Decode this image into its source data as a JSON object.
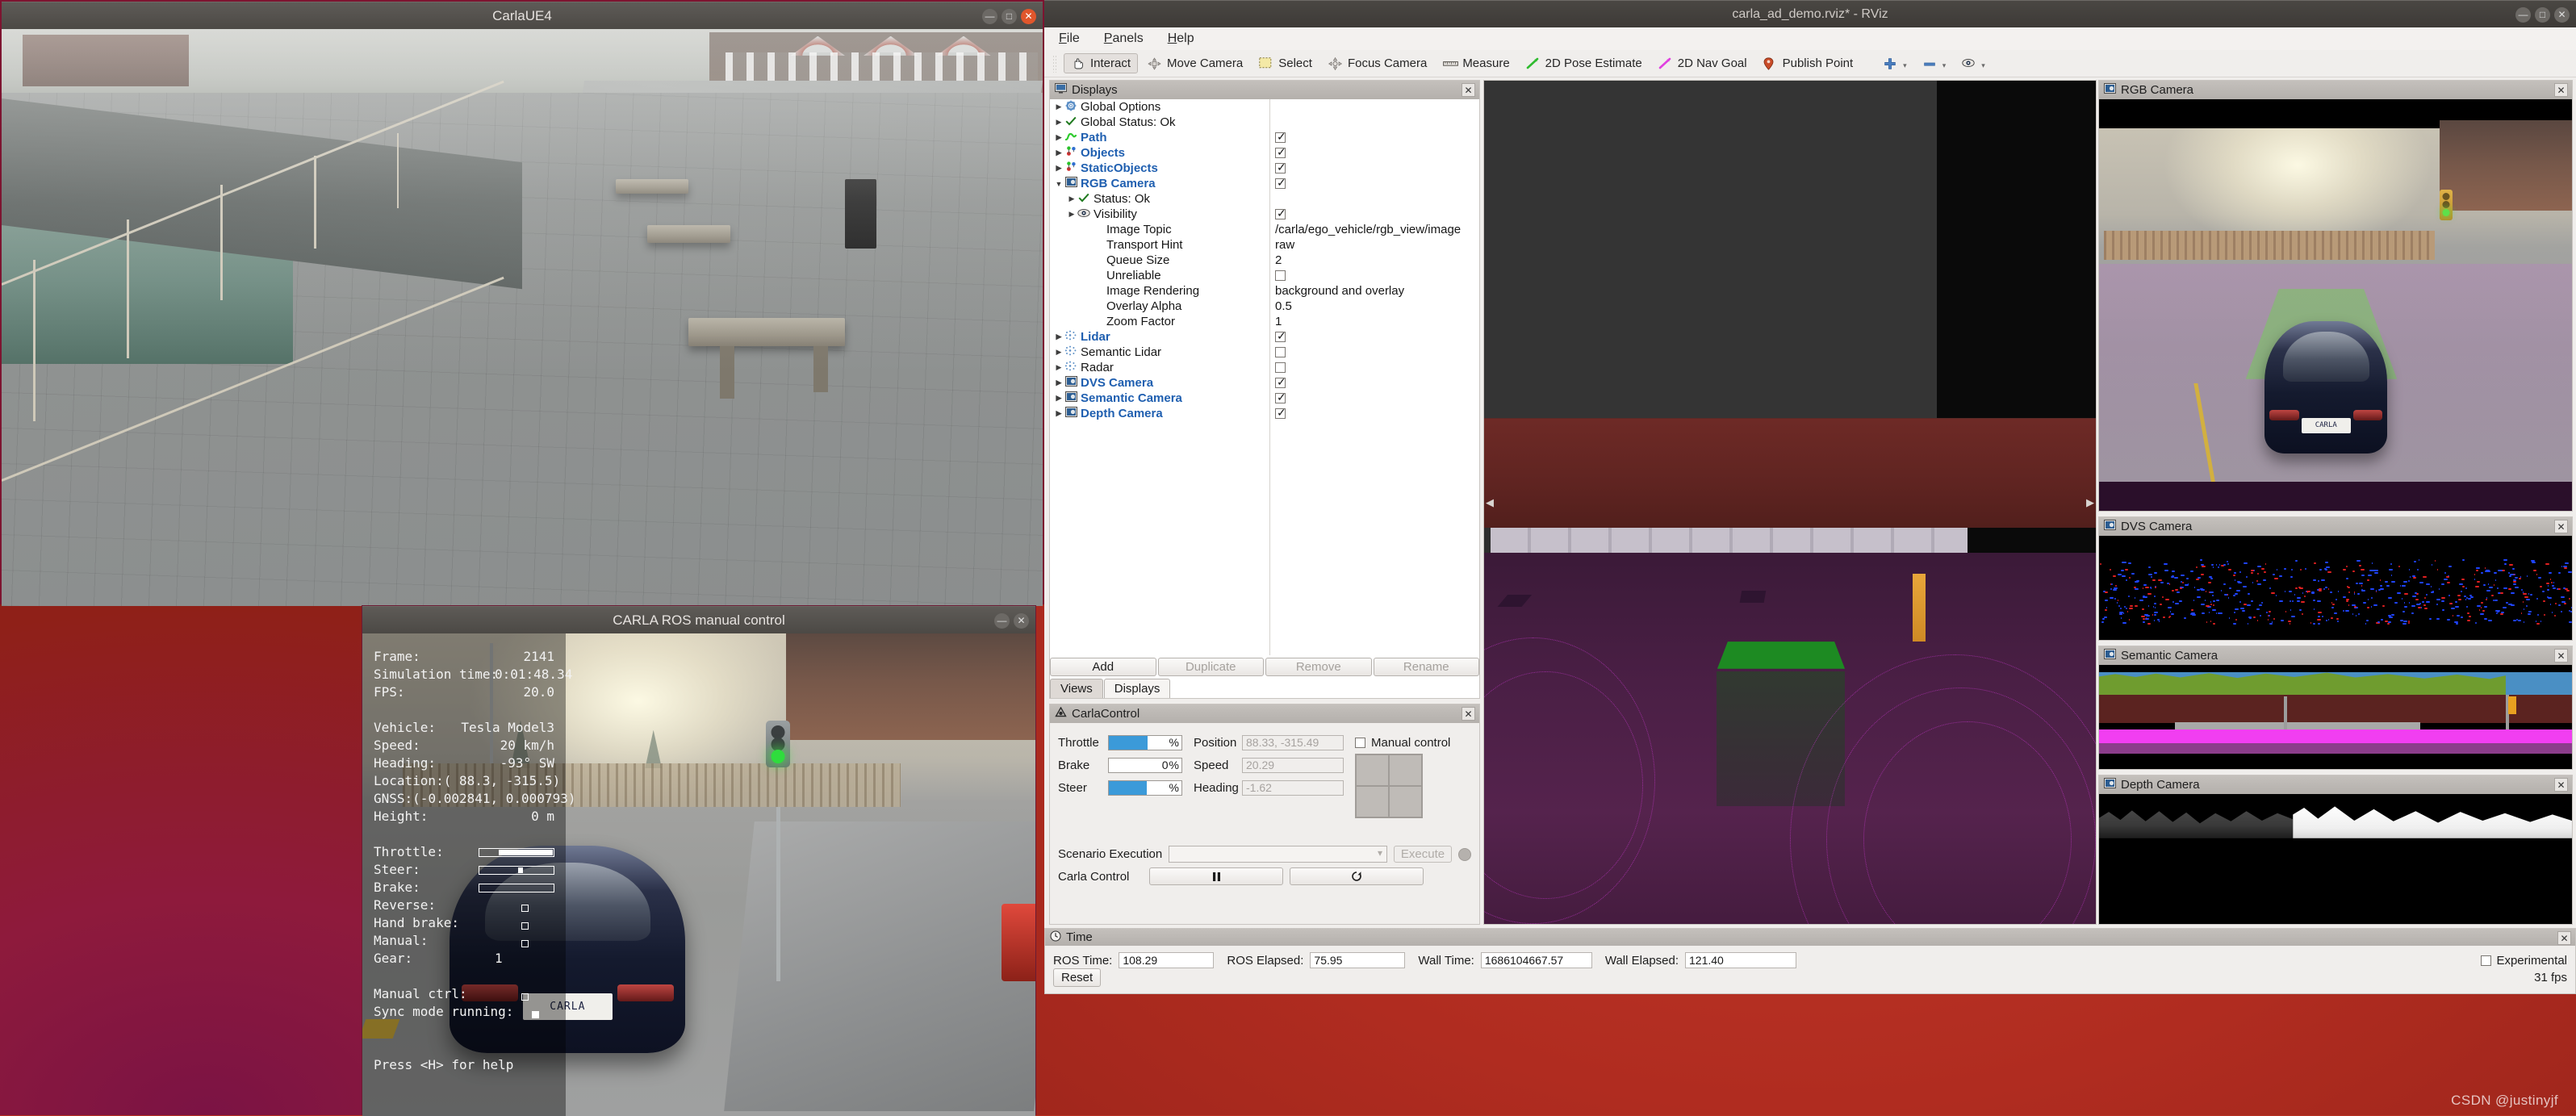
{
  "desktop": {
    "watermark": "CSDN @justinyjf"
  },
  "carla_ue4": {
    "title": "CarlaUE4",
    "buttons": {
      "minimize": "—",
      "maximize": "□",
      "close": "✕"
    }
  },
  "manual_control": {
    "title": "CARLA ROS manual control",
    "buttons": {
      "minimize": "—",
      "close": "✕"
    },
    "hud": {
      "frame_label": "Frame:",
      "frame_value": "2141",
      "sim_time_label": "Simulation time:",
      "sim_time_value": "0:01:48.34",
      "fps_label": "FPS:",
      "fps_value": "20.0",
      "vehicle_label": "Vehicle:",
      "vehicle_value": "Tesla Model3",
      "speed_label": "Speed:",
      "speed_value": "20 km/h",
      "heading_label": "Heading:",
      "heading_value": "-93° SW",
      "location_label": "Location:",
      "location_value": "( 88.3, -315.5)",
      "gnss_label": "GNSS:",
      "gnss_value": "(-0.002841, 0.000793)",
      "height_label": "Height:",
      "height_value": "0 m",
      "throttle_label": "Throttle:",
      "throttle_pct": 74,
      "steer_label": "Steer:",
      "steer_pct": 52,
      "brake_label": "Brake:",
      "brake_pct": 0,
      "reverse_label": "Reverse:",
      "reverse_on": false,
      "hand_brake_label": "Hand brake:",
      "hand_brake_on": false,
      "manual_label": "Manual:",
      "manual_on": false,
      "gear_label": "Gear:",
      "gear_value": "1",
      "manual_ctrl_label": "Manual ctrl:",
      "manual_ctrl_on": false,
      "sync_mode_label": "Sync mode running:",
      "sync_mode_on": true,
      "help_text": "Press <H> for help"
    },
    "scene": {
      "plate_text": "CARLA"
    }
  },
  "rviz": {
    "title": "carla_ad_demo.rviz* - RViz",
    "buttons": {
      "minimize": "—",
      "maximize": "□",
      "close": "✕"
    },
    "menu": [
      {
        "label": "File",
        "mnemonic": "F"
      },
      {
        "label": "Panels",
        "mnemonic": "P"
      },
      {
        "label": "Help",
        "mnemonic": "H"
      }
    ],
    "toolbar": [
      {
        "label": "Interact",
        "icon": "hand-icon",
        "active": true
      },
      {
        "label": "Move Camera",
        "icon": "move-camera-icon",
        "active": false
      },
      {
        "label": "Select",
        "icon": "select-rect-icon",
        "active": false
      },
      {
        "label": "Focus Camera",
        "icon": "focus-camera-icon",
        "active": false
      },
      {
        "label": "Measure",
        "icon": "ruler-icon",
        "active": false
      },
      {
        "label": "2D Pose Estimate",
        "icon": "pose-arrow-icon",
        "active": false
      },
      {
        "label": "2D Nav Goal",
        "icon": "nav-goal-arrow-icon",
        "active": false
      },
      {
        "label": "Publish Point",
        "icon": "map-pin-icon",
        "active": false
      }
    ],
    "toolbar_extra": [
      {
        "icon": "plus-icon"
      },
      {
        "icon": "minus-icon"
      },
      {
        "icon": "eye-icon"
      }
    ],
    "displays_panel": {
      "title": "Displays",
      "close_label": "✕",
      "tree": [
        {
          "label": "Global Options",
          "icon": "gear-icon",
          "arrow": true,
          "indent": 0,
          "blue": false,
          "value": null,
          "check": null
        },
        {
          "label": "Global Status: Ok",
          "icon": "check-icon",
          "arrow": true,
          "indent": 0,
          "blue": false,
          "value": null,
          "check": null
        },
        {
          "label": "Path",
          "icon": "path-icon",
          "arrow": true,
          "indent": 0,
          "blue": true,
          "value": null,
          "check": true
        },
        {
          "label": "Objects",
          "icon": "markers-icon",
          "arrow": true,
          "indent": 0,
          "blue": true,
          "value": null,
          "check": true
        },
        {
          "label": "StaticObjects",
          "icon": "markers-icon",
          "arrow": true,
          "indent": 0,
          "blue": true,
          "value": null,
          "check": true
        },
        {
          "label": "RGB Camera",
          "icon": "camera-icon",
          "arrow": "down",
          "indent": 0,
          "blue": true,
          "value": null,
          "check": true
        },
        {
          "label": "Status: Ok",
          "icon": "check-icon",
          "arrow": true,
          "indent": 1,
          "blue": false,
          "value": null,
          "check": null
        },
        {
          "label": "Visibility",
          "icon": "eye-icon",
          "arrow": true,
          "indent": 1,
          "blue": false,
          "value": null,
          "check": true
        },
        {
          "label": "Image Topic",
          "icon": null,
          "arrow": false,
          "indent": 2,
          "blue": false,
          "value": "/carla/ego_vehicle/rgb_view/image",
          "check": null
        },
        {
          "label": "Transport Hint",
          "icon": null,
          "arrow": false,
          "indent": 2,
          "blue": false,
          "value": "raw",
          "check": null
        },
        {
          "label": "Queue Size",
          "icon": null,
          "arrow": false,
          "indent": 2,
          "blue": false,
          "value": "2",
          "check": null
        },
        {
          "label": "Unreliable",
          "icon": null,
          "arrow": false,
          "indent": 2,
          "blue": false,
          "value": null,
          "check": false
        },
        {
          "label": "Image Rendering",
          "icon": null,
          "arrow": false,
          "indent": 2,
          "blue": false,
          "value": "background and overlay",
          "check": null
        },
        {
          "label": "Overlay Alpha",
          "icon": null,
          "arrow": false,
          "indent": 2,
          "blue": false,
          "value": "0.5",
          "check": null
        },
        {
          "label": "Zoom Factor",
          "icon": null,
          "arrow": false,
          "indent": 2,
          "blue": false,
          "value": "1",
          "check": null
        },
        {
          "label": "Lidar",
          "icon": "pointcloud-icon",
          "arrow": true,
          "indent": 0,
          "blue": true,
          "value": null,
          "check": true
        },
        {
          "label": "Semantic Lidar",
          "icon": "pointcloud-icon",
          "arrow": true,
          "indent": 0,
          "blue": false,
          "value": null,
          "check": false
        },
        {
          "label": "Radar",
          "icon": "pointcloud-icon",
          "arrow": true,
          "indent": 0,
          "blue": false,
          "value": null,
          "check": false
        },
        {
          "label": "DVS Camera",
          "icon": "camera-icon",
          "arrow": true,
          "indent": 0,
          "blue": true,
          "value": null,
          "check": true
        },
        {
          "label": "Semantic Camera",
          "icon": "camera-icon",
          "arrow": true,
          "indent": 0,
          "blue": true,
          "value": null,
          "check": true
        },
        {
          "label": "Depth Camera",
          "icon": "camera-icon",
          "arrow": true,
          "indent": 0,
          "blue": true,
          "value": null,
          "check": true
        }
      ],
      "buttons": [
        {
          "label": "Add",
          "enabled": true
        },
        {
          "label": "Duplicate",
          "enabled": false
        },
        {
          "label": "Remove",
          "enabled": false
        },
        {
          "label": "Rename",
          "enabled": false
        }
      ],
      "tabs": [
        {
          "label": "Views",
          "selected": false
        },
        {
          "label": "Displays",
          "selected": true
        }
      ]
    },
    "carla_control_panel": {
      "title": "CarlaControl",
      "close_label": "✕",
      "throttle_label": "Throttle",
      "throttle_value": "53",
      "throttle_unit": "%",
      "throttle_pct": 53,
      "brake_label": "Brake",
      "brake_value": "0",
      "brake_unit": "%",
      "brake_pct": 0,
      "steer_label": "Steer",
      "steer_value": "52",
      "steer_unit": "%",
      "steer_pct": 52,
      "position_label": "Position",
      "position_value": "88.33, -315.49",
      "speed_label": "Speed",
      "speed_value": "20.29",
      "heading_label": "Heading",
      "heading_value": "-1.62",
      "manual_control_label": "Manual control",
      "manual_control_checked": false,
      "scenario_label": "Scenario Execution",
      "scenario_value": "",
      "execute_label": "Execute",
      "carla_control_label": "Carla Control",
      "pause_icon": "pause-icon",
      "step_icon": "step-forward-icon",
      "accent_color": "#3b9ad9"
    },
    "cameras": [
      {
        "title": "RGB Camera",
        "icon": "camera-icon",
        "close_label": "✕"
      },
      {
        "title": "DVS Camera",
        "icon": "camera-icon",
        "close_label": "✕"
      },
      {
        "title": "Semantic Camera",
        "icon": "camera-icon",
        "close_label": "✕"
      },
      {
        "title": "Depth Camera",
        "icon": "camera-icon",
        "close_label": "✕"
      }
    ],
    "time_panel": {
      "title": "Time",
      "icon": "clock-icon",
      "close_label": "✕",
      "ros_time_label": "ROS Time:",
      "ros_time_value": "108.29",
      "ros_elapsed_label": "ROS Elapsed:",
      "ros_elapsed_value": "75.95",
      "wall_time_label": "Wall Time:",
      "wall_time_value": "1686104667.57",
      "wall_elapsed_label": "Wall Elapsed:",
      "wall_elapsed_value": "121.40",
      "reset_label": "Reset",
      "experimental_label": "Experimental",
      "experimental_checked": false,
      "fps_label": "31 fps"
    }
  }
}
